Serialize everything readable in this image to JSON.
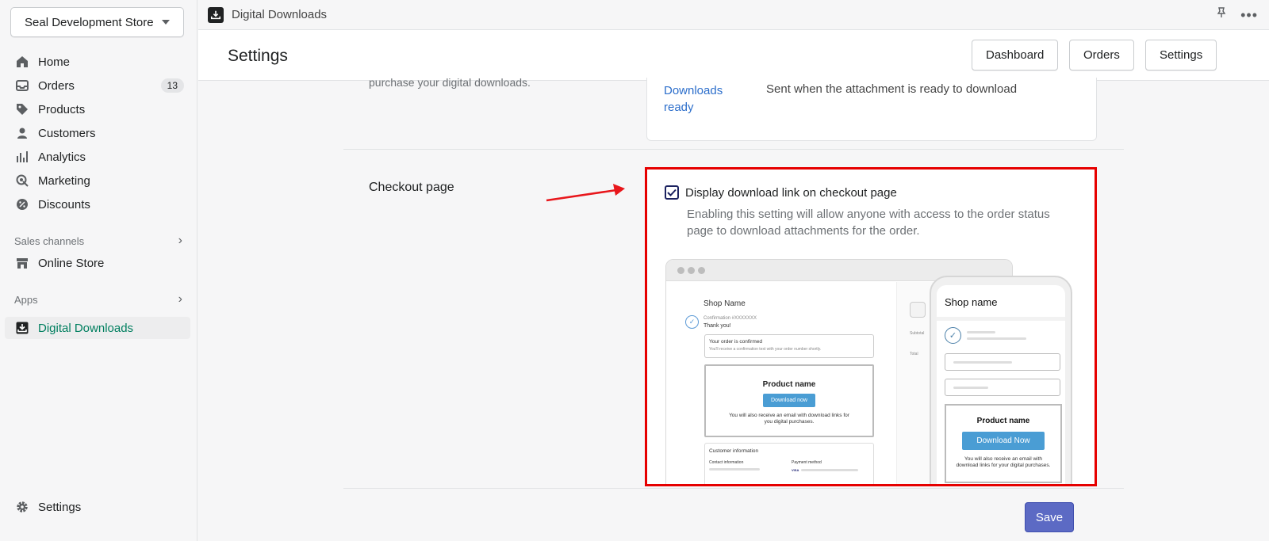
{
  "sidebar": {
    "store_name": "Seal Development Store",
    "items": [
      {
        "label": "Home",
        "icon": "home-icon"
      },
      {
        "label": "Orders",
        "icon": "inbox-icon",
        "badge": "13"
      },
      {
        "label": "Products",
        "icon": "tag-icon"
      },
      {
        "label": "Customers",
        "icon": "person-icon"
      },
      {
        "label": "Analytics",
        "icon": "bar-chart-icon"
      },
      {
        "label": "Marketing",
        "icon": "target-icon"
      },
      {
        "label": "Discounts",
        "icon": "discount-icon"
      }
    ],
    "sales_channels_label": "Sales channels",
    "online_store_label": "Online Store",
    "apps_label": "Apps",
    "digital_downloads_label": "Digital Downloads",
    "settings_label": "Settings"
  },
  "topbar": {
    "app_title": "Digital Downloads"
  },
  "header": {
    "title": "Settings",
    "buttons": [
      "Dashboard",
      "Orders",
      "Settings"
    ]
  },
  "content": {
    "partial_text": "purchase your digital downloads.",
    "email_link": "Downloads ready",
    "email_desc": "Sent when the attachment is ready to download",
    "section_title": "Checkout page",
    "checkbox_label": "Display download link on checkout page",
    "checkbox_checked": true,
    "checkbox_help": "Enabling this setting will allow anyone with access to the order status page to download attachments for the order.",
    "save_label": "Save"
  },
  "illustration": {
    "desktop": {
      "shop_name": "Shop Name",
      "confirmation": "Confirmation #XXXXXXX",
      "thanks": "Thank you!",
      "confirmed_title": "Your order is confirmed",
      "confirmed_sub": "You'll receive a confirmation text with your order number shortly.",
      "product_name": "Product name",
      "download_btn": "Download now",
      "note": "You will also receive an email with download links for you digital purchases.",
      "customer_info": "Customer information",
      "contact_info": "Contact information",
      "payment_method": "Payment method",
      "card_brand": "VISA",
      "subtotal": "Subtotal",
      "total": "Total"
    },
    "mobile": {
      "shop_name": "Shop name",
      "product_name": "Product name",
      "download_btn": "Download Now",
      "note": "You will also receive an email with download links for your digital purchases."
    }
  },
  "colors": {
    "accent_green": "#007f5f",
    "link_blue": "#2c6ecb",
    "primary_button": "#5c6ac4",
    "highlight_red": "#e60000",
    "arrow_red": "#e8161b"
  }
}
